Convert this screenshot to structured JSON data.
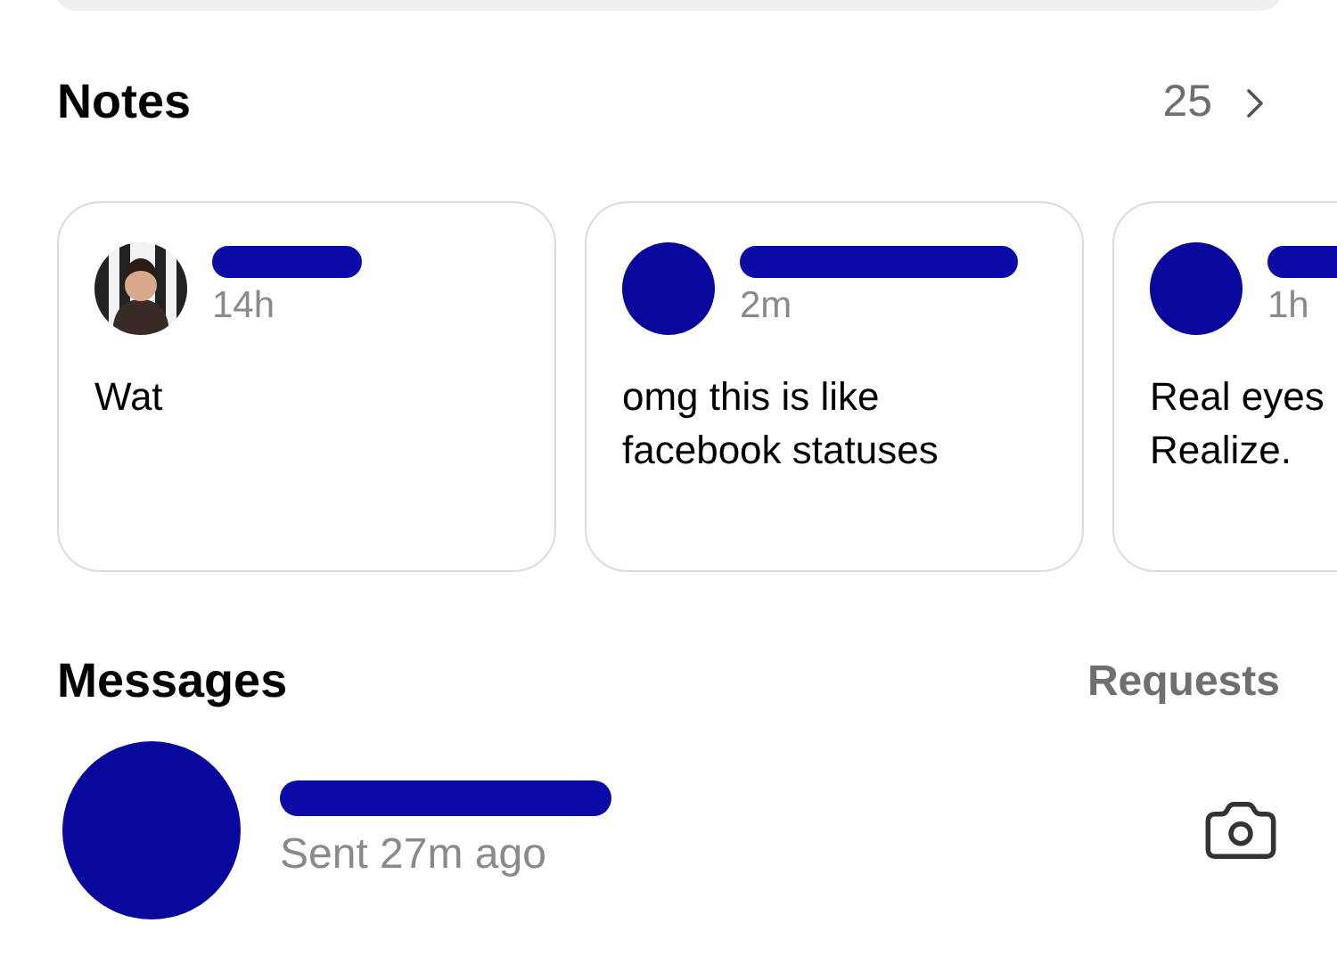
{
  "notes": {
    "title": "Notes",
    "count": "25",
    "items": [
      {
        "time": "14h",
        "lines": [
          "Wat"
        ]
      },
      {
        "kind": "plain",
        "time": "2m",
        "lines": [
          "omg this is like",
          "facebook statuses"
        ]
      },
      {
        "kind": "plain",
        "time": "1h",
        "lines": [
          "Real eyes",
          "Realize."
        ]
      }
    ]
  },
  "messages": {
    "title": "Messages",
    "requests": "Requests",
    "items": [
      {
        "kind": "plain",
        "status": "Sent 27m ago"
      }
    ]
  }
}
